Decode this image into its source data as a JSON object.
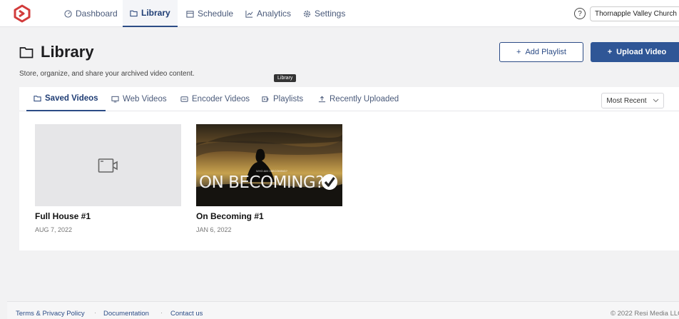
{
  "nav": {
    "items": [
      {
        "label": "Dashboard",
        "icon": "dashboard-icon"
      },
      {
        "label": "Library",
        "icon": "folder-icon"
      },
      {
        "label": "Schedule",
        "icon": "calendar-icon"
      },
      {
        "label": "Analytics",
        "icon": "chart-icon"
      },
      {
        "label": "Settings",
        "icon": "gear-icon"
      }
    ],
    "help_label": "?",
    "organization": "Thornapple Valley Church"
  },
  "page": {
    "title": "Library",
    "subtitle": "Store, organize, and share your archived video content.",
    "tooltip": "Library",
    "add_playlist_label": "Add Playlist",
    "upload_video_label": "Upload Video"
  },
  "tabs": [
    {
      "label": "Saved Videos"
    },
    {
      "label": "Web Videos"
    },
    {
      "label": "Encoder Videos"
    },
    {
      "label": "Playlists"
    },
    {
      "label": "Recently Uploaded"
    }
  ],
  "sort": {
    "selected": "Most Recent"
  },
  "videos": [
    {
      "title": "Full House #1",
      "date": "AUG 7, 2022"
    },
    {
      "title": "On Becoming #1",
      "date": "JAN 6, 2022",
      "thumb_text": "ON BECOMING?",
      "thumb_small_text": "WHO AM I BECOMING?"
    }
  ],
  "footer": {
    "terms": "Terms & Privacy Policy",
    "docs": "Documentation",
    "contact": "Contact us",
    "separator": "·",
    "copyright": "© 2022 Resi Media LLC"
  },
  "colors": {
    "accent": "#2f5696",
    "brand": "#d23b3b"
  }
}
